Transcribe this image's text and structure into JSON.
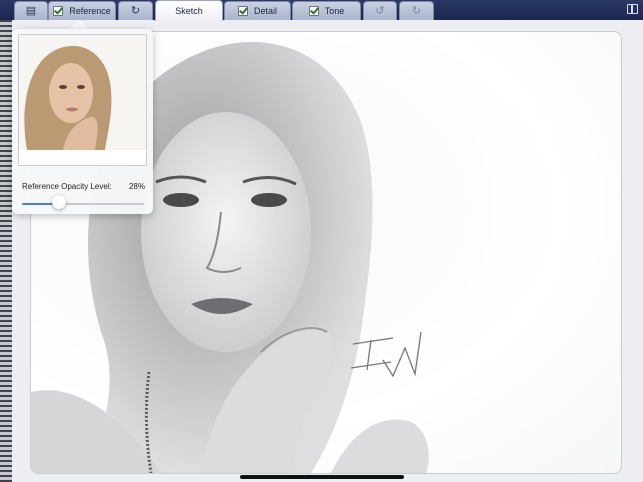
{
  "toolbar": {
    "tabs": {
      "menu": {
        "icon": "menu-icon"
      },
      "reference": {
        "label": "Reference",
        "checked": true
      },
      "flip": {
        "icon": "rotate-icon"
      },
      "sketch": {
        "label": "Sketch",
        "active": true
      },
      "detail": {
        "label": "Detail",
        "checked": true
      },
      "tone": {
        "label": "Tone",
        "checked": true
      },
      "undo": {
        "icon": "undo-icon"
      },
      "redo": {
        "icon": "redo-icon"
      }
    },
    "panel_toggle": {
      "icon": "split-panel-icon"
    }
  },
  "reference_popover": {
    "opacity_label": "Reference Opacity Level:",
    "opacity_value": "28%",
    "opacity_fraction": 0.28
  },
  "colors": {
    "toolbar_bg": "#1b2650",
    "tab_bg": "#b3bdd2",
    "accent": "#4a7fd6"
  }
}
